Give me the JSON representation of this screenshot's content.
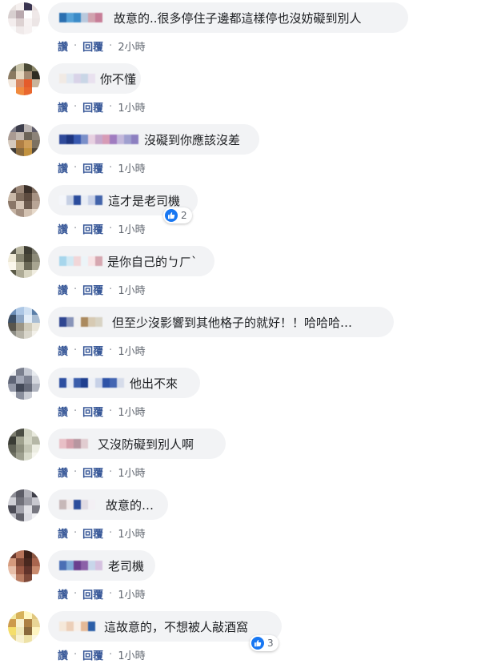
{
  "actions": {
    "like": "讚",
    "reply": "回覆",
    "separator": "·"
  },
  "comments": [
    {
      "text": "故意的..很多停住子邊都這樣停也沒妨礙到別人",
      "time": "2小時",
      "likes": ""
    },
    {
      "text": "你不懂",
      "time": "1小時",
      "likes": ""
    },
    {
      "text": "沒礙到你應該沒差",
      "time": "1小時",
      "likes": ""
    },
    {
      "text": "這才是老司機",
      "time": "1小時",
      "likes": "2"
    },
    {
      "text": "是你自己的ㄅㄏˋ",
      "time": "1小時",
      "likes": ""
    },
    {
      "text": "但至少沒影響到其他格子的就好！！哈哈哈…",
      "time": "1小時",
      "likes": ""
    },
    {
      "text": "他出不來",
      "time": "1小時",
      "likes": ""
    },
    {
      "text": "又沒防礙到別人啊",
      "time": "1小時",
      "likes": ""
    },
    {
      "text": "故意的…",
      "time": "1小時",
      "likes": ""
    },
    {
      "text": "老司機",
      "time": "1小時",
      "likes": ""
    },
    {
      "text": "這故意的，不想被人敲酒窩",
      "time": "1小時",
      "likes": "3"
    }
  ],
  "colors": {
    "link": "#385898",
    "bubble": "#f2f3f5",
    "like_badge": "#1877f2"
  },
  "icons": {
    "reaction": "thumbs-up-icon"
  }
}
